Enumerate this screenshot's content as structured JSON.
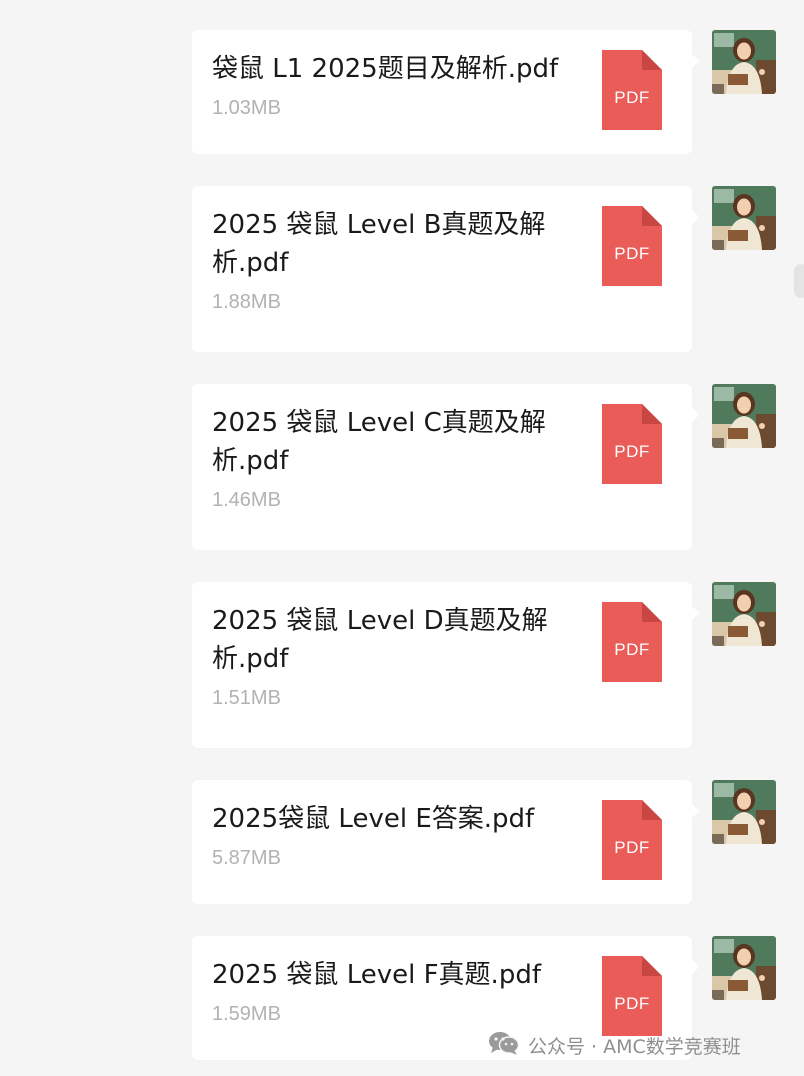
{
  "files": [
    {
      "name": "袋鼠 L1 2025题目及解析.pdf",
      "size": "1.03MB",
      "icon_label": "PDF"
    },
    {
      "name": "2025 袋鼠 Level B真题及解析.pdf",
      "size": "1.88MB",
      "icon_label": "PDF"
    },
    {
      "name": "2025 袋鼠 Level C真题及解析.pdf",
      "size": "1.46MB",
      "icon_label": "PDF"
    },
    {
      "name": "2025 袋鼠 Level D真题及解析.pdf",
      "size": "1.51MB",
      "icon_label": "PDF"
    },
    {
      "name": "2025袋鼠 Level E答案.pdf",
      "size": "5.87MB",
      "icon_label": "PDF"
    },
    {
      "name": "2025 袋鼠 Level F真题.pdf",
      "size": "1.59MB",
      "icon_label": "PDF"
    }
  ],
  "avatar_icon": "teacher-avatar-icon",
  "file_icon": "pdf-file-icon",
  "watermark": {
    "icon": "wechat-icon",
    "text": "公众号 · AMC数学竞赛班"
  },
  "colors": {
    "background": "#f5f5f5",
    "bubble": "#ffffff",
    "pdf_red": "#e95c57",
    "pdf_fold": "#c84742",
    "size_text": "#b2b2b2"
  }
}
